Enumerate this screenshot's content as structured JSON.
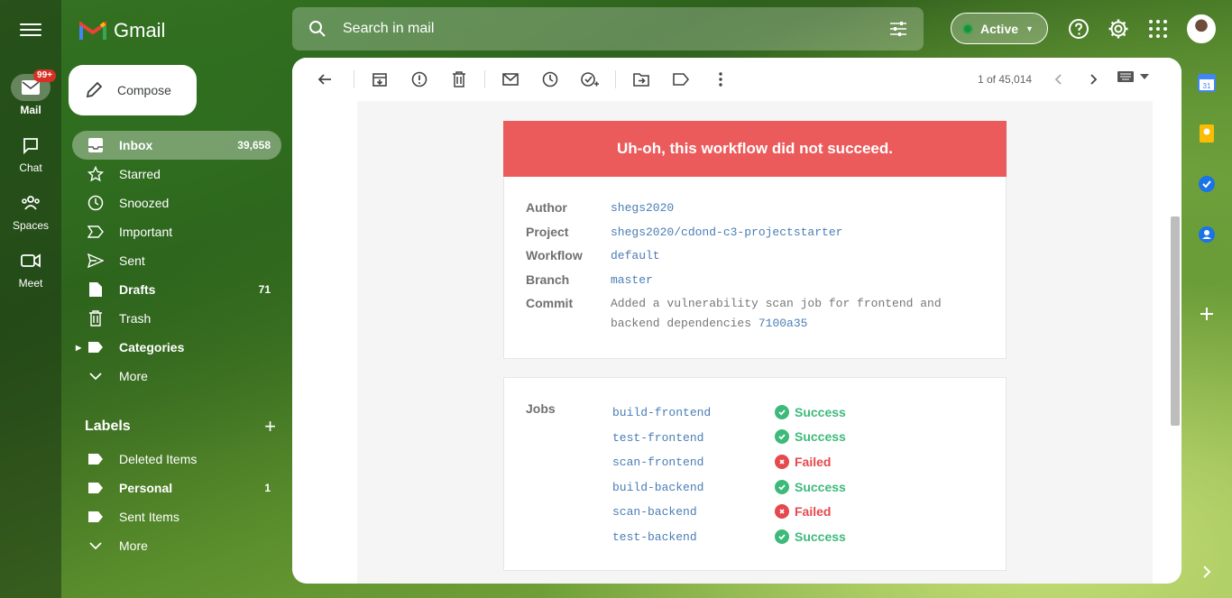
{
  "app": {
    "name": "Gmail"
  },
  "rail": {
    "items": [
      {
        "label": "Mail",
        "badge": "99+"
      },
      {
        "label": "Chat"
      },
      {
        "label": "Spaces"
      },
      {
        "label": "Meet"
      }
    ]
  },
  "compose": {
    "label": "Compose"
  },
  "nav": [
    {
      "label": "Inbox",
      "count": "39,658",
      "icon": "inbox-icon"
    },
    {
      "label": "Starred",
      "count": "",
      "icon": "star-icon"
    },
    {
      "label": "Snoozed",
      "count": "",
      "icon": "clock-icon"
    },
    {
      "label": "Important",
      "count": "",
      "icon": "important-icon"
    },
    {
      "label": "Sent",
      "count": "",
      "icon": "send-icon"
    },
    {
      "label": "Drafts",
      "count": "71",
      "icon": "draft-icon"
    },
    {
      "label": "Trash",
      "count": "",
      "icon": "trash-icon"
    },
    {
      "label": "Categories",
      "count": "",
      "icon": "label-icon"
    },
    {
      "label": "More",
      "count": "",
      "icon": "chevron-down-icon"
    }
  ],
  "labels": {
    "title": "Labels",
    "items": [
      {
        "label": "Deleted Items",
        "count": ""
      },
      {
        "label": "Personal",
        "count": "1"
      },
      {
        "label": "Sent Items",
        "count": ""
      },
      {
        "label": "More",
        "count": ""
      }
    ]
  },
  "search": {
    "placeholder": "Search in mail"
  },
  "status": {
    "label": "Active",
    "color": "#1e8e3e"
  },
  "toolbar": {
    "pager": "1 of 45,014"
  },
  "email": {
    "banner": "Uh-oh, this workflow did not succeed.",
    "banner_color": "#ec5b5b",
    "fields": {
      "author_label": "Author",
      "author": "shegs2020",
      "project_label": "Project",
      "project": "shegs2020/cdond-c3-projectstarter",
      "workflow_label": "Workflow",
      "workflow": "default",
      "branch_label": "Branch",
      "branch": "master",
      "commit_label": "Commit",
      "commit_line1": "Added a vulnerability scan job for frontend and",
      "commit_line2": "backend dependencies",
      "commit_hash": "7100a35"
    },
    "jobs_label": "Jobs",
    "jobs": [
      {
        "name": "build-frontend",
        "status": "Success"
      },
      {
        "name": "test-frontend",
        "status": "Success"
      },
      {
        "name": "scan-frontend",
        "status": "Failed"
      },
      {
        "name": "build-backend",
        "status": "Success"
      },
      {
        "name": "scan-backend",
        "status": "Failed"
      },
      {
        "name": "test-backend",
        "status": "Success"
      }
    ],
    "success_color": "#3dba7a",
    "failed_color": "#e5484d"
  }
}
